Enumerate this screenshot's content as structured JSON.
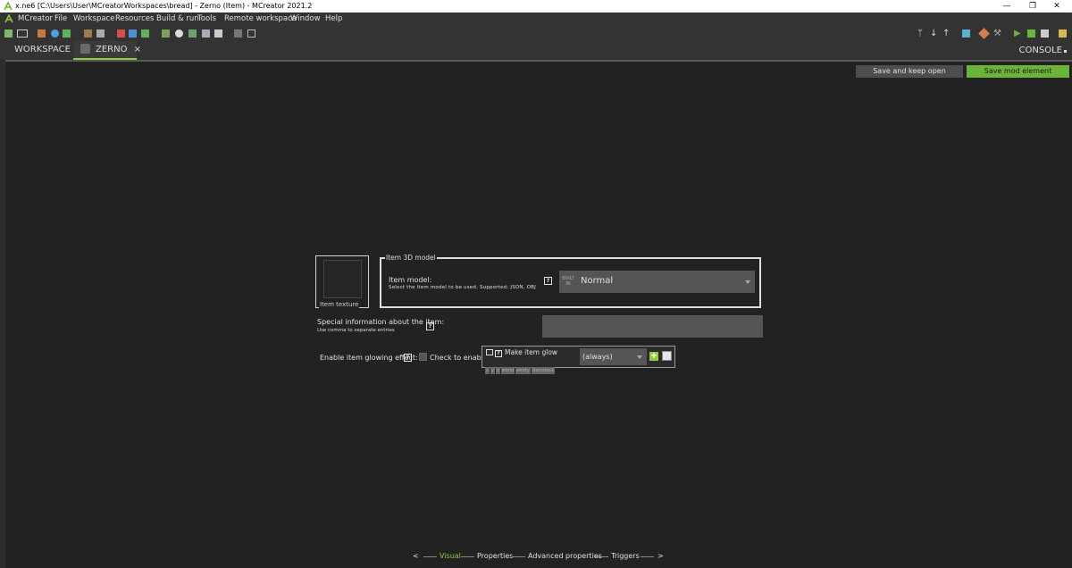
{
  "window": {
    "title": "x.ne6 [C:\\Users\\User\\MCreatorWorkspaces\\bread] - Zerno (Item) - MCreator 2021.2",
    "minimize": "—",
    "restore": "❐",
    "close": "✕"
  },
  "menu": [
    "MCreator",
    "File",
    "Workspace",
    "Resources",
    "Build & run",
    "Tools",
    "Remote workspace",
    "Window",
    "Help"
  ],
  "tabs": {
    "workspace": "WORKSPACE",
    "zerno": "ZERNO",
    "close_glyph": "×",
    "console": "CONSOLE"
  },
  "actions": {
    "save_keep_open": "Save and keep open",
    "save_element": "Save mod element"
  },
  "texture": {
    "label": "Item texture"
  },
  "model": {
    "group_title": "Item 3D model",
    "label": "Item model:",
    "hint": "Select the item model to be used. Supported: JSON, OBJ",
    "help": "?",
    "builtin_badge": "BUILT IN",
    "value": "Normal"
  },
  "special_info": {
    "label": "Special information about the item:",
    "hint": "Use comma to separate entries",
    "help": "?",
    "value": ""
  },
  "glow": {
    "label": "Enable item glowing effect:",
    "help": "?",
    "checkbox_label": "Check to enable",
    "procedure_title": "Make item glow",
    "deps": [
      "x",
      "y",
      "z",
      "world",
      "entity",
      "itemstack"
    ],
    "procedure_value": "(always)",
    "add": "+"
  },
  "bottom_nav": {
    "prev": "<",
    "visual": "Visual",
    "properties": "Properties",
    "advanced": "Advanced properties",
    "triggers": "Triggers",
    "next": ">"
  },
  "colors": {
    "accent": "#8ecb3d",
    "background": "#222222",
    "field": "#555555"
  }
}
